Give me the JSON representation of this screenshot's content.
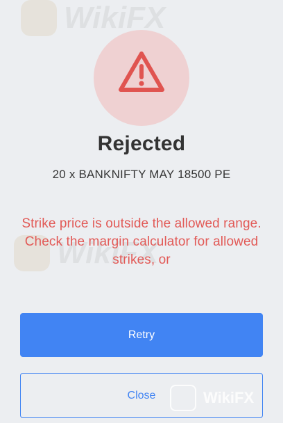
{
  "status": {
    "icon": "warning-triangle-icon",
    "circle_color": "#efd1d2",
    "icon_color": "#e05450"
  },
  "dialog": {
    "title": "Rejected",
    "order_description": "20 x BANKNIFTY MAY 18500 PE",
    "error_message": "Strike price is outside the allowed range. Check the margin calculator for allowed strikes, or"
  },
  "buttons": {
    "retry_label": "Retry",
    "close_label": "Close"
  },
  "watermark": {
    "text": "WikiFX"
  },
  "colors": {
    "accent": "#4184f3",
    "error": "#e25a57",
    "background": "#eceef1"
  }
}
